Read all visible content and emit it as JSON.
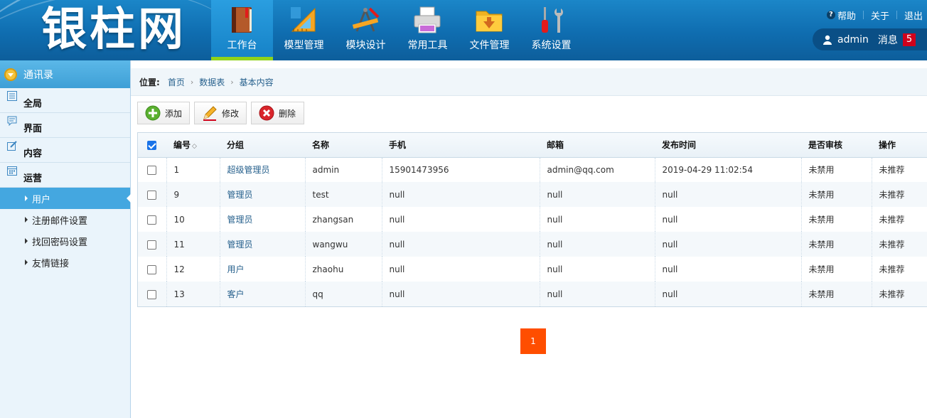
{
  "header": {
    "logo": "银柱网",
    "nav": [
      {
        "label": "工作台",
        "icon": "book-icon",
        "active": true
      },
      {
        "label": "模型管理",
        "icon": "ruler-icon",
        "active": false
      },
      {
        "label": "模块设计",
        "icon": "drafting-tools-icon",
        "active": false
      },
      {
        "label": "常用工具",
        "icon": "printer-icon",
        "active": false
      },
      {
        "label": "文件管理",
        "icon": "folder-icon",
        "active": false
      },
      {
        "label": "系统设置",
        "icon": "wrench-screwdriver-icon",
        "active": false
      }
    ],
    "links": {
      "help": "帮助",
      "about": "关于",
      "logout": "退出"
    },
    "user": {
      "name": "admin",
      "messages_label": "消息",
      "message_count": "5"
    }
  },
  "sidebar": {
    "title": "通讯录",
    "groups": [
      {
        "label": "全局",
        "icon": "list-icon"
      },
      {
        "label": "界面",
        "icon": "chat-icon"
      },
      {
        "label": "内容",
        "icon": "edit-icon"
      },
      {
        "label": "运营",
        "icon": "calendar-icon"
      }
    ],
    "items": [
      {
        "label": "用户",
        "active": true
      },
      {
        "label": "注册邮件设置",
        "active": false
      },
      {
        "label": "找回密码设置",
        "active": false
      },
      {
        "label": "友情链接",
        "active": false
      }
    ]
  },
  "breadcrumb": {
    "label": "位置:",
    "items": [
      "首页",
      "数据表",
      "基本内容"
    ]
  },
  "toolbar": {
    "add": "添加",
    "edit": "修改",
    "delete": "删除"
  },
  "table": {
    "headers": [
      "编号",
      "分组",
      "名称",
      "手机",
      "邮箱",
      "发布时间",
      "是否审核",
      "操作"
    ],
    "rows": [
      [
        "1",
        "超级管理员",
        "admin",
        "15901473956",
        "admin@qq.com",
        "2019-04-29 11:02:54",
        "未禁用",
        "未推荐"
      ],
      [
        "9",
        "管理员",
        "test",
        "null",
        "null",
        "null",
        "未禁用",
        "未推荐"
      ],
      [
        "10",
        "管理员",
        "zhangsan",
        "null",
        "null",
        "null",
        "未禁用",
        "未推荐"
      ],
      [
        "11",
        "管理员",
        "wangwu",
        "null",
        "null",
        "null",
        "未禁用",
        "未推荐"
      ],
      [
        "12",
        "用户",
        "zhaohu",
        "null",
        "null",
        "null",
        "未禁用",
        "未推荐"
      ],
      [
        "13",
        "客户",
        "qq",
        "null",
        "null",
        "null",
        "未禁用",
        "未推荐"
      ]
    ]
  },
  "pagination": {
    "current": "1"
  },
  "colors": {
    "accent": "#1581c6",
    "active_nav_underline": "#8fd31a",
    "pager": "#ff4e00",
    "badge": "#d0021b"
  }
}
